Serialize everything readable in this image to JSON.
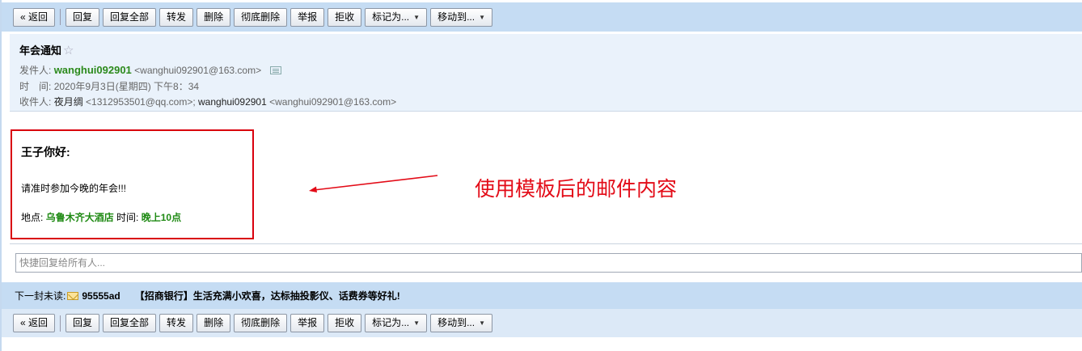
{
  "toolbar": {
    "back": "« 返回",
    "reply": "回复",
    "reply_all": "回复全部",
    "forward": "转发",
    "delete": "删除",
    "delete_forever": "彻底删除",
    "report": "举报",
    "reject": "拒收",
    "mark_as": "标记为...",
    "move_to": "移动到..."
  },
  "email": {
    "subject": "年会通知",
    "star": "☆",
    "from_label": "发件人:",
    "from_name": "wanghui092901",
    "from_addr": "<wanghui092901@163.com>",
    "time_label": "时　间:",
    "time_value": "2020年9月3日(星期四) 下午8：34",
    "to_label": "收件人:",
    "to_name1": "夜月绸",
    "to_addr1": "<1312953501@qq.com>;",
    "to_name2": "wanghui092901",
    "to_addr2": "<wanghui092901@163.com>"
  },
  "body": {
    "greeting": "王子你好:",
    "line2": "请准时参加今晚的年会!!!",
    "place_label": "地点:",
    "place_value": "乌鲁木齐大酒店",
    "time_label": "时间:",
    "time_value": "晚上10点"
  },
  "annotation": {
    "text": "使用模板后的邮件内容",
    "color": "#e30b17"
  },
  "quick_reply": {
    "placeholder": "快捷回复给所有人..."
  },
  "next_unread": {
    "label": "下一封未读:",
    "sender": "95555ad",
    "subject": "【招商银行】生活充满小欢喜，达标抽投影仪、话费券等好礼!"
  }
}
